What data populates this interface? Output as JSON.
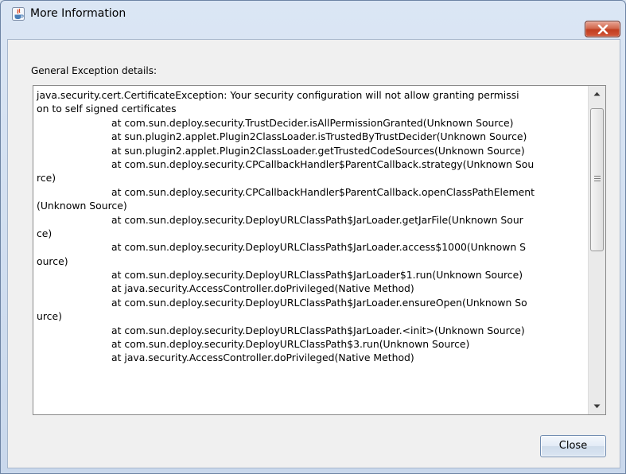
{
  "window": {
    "title": "More Information",
    "close_icon": "close-icon"
  },
  "section_label": "General Exception details:",
  "details_lines": [
    {
      "text": "java.security.cert.CertificateException: Your security configuration will not allow granting permissi",
      "indent": false
    },
    {
      "text": "on to self signed certificates",
      "indent": false
    },
    {
      "text": "at com.sun.deploy.security.TrustDecider.isAllPermissionGranted(Unknown Source)",
      "indent": true
    },
    {
      "text": "at sun.plugin2.applet.Plugin2ClassLoader.isTrustedByTrustDecider(Unknown Source)",
      "indent": true
    },
    {
      "text": "at sun.plugin2.applet.Plugin2ClassLoader.getTrustedCodeSources(Unknown Source)",
      "indent": true
    },
    {
      "text": "at com.sun.deploy.security.CPCallbackHandler$ParentCallback.strategy(Unknown Sou",
      "indent": true
    },
    {
      "text": "rce)",
      "indent": false
    },
    {
      "text": "at com.sun.deploy.security.CPCallbackHandler$ParentCallback.openClassPathElement",
      "indent": true
    },
    {
      "text": "(Unknown Source)",
      "indent": false
    },
    {
      "text": "at com.sun.deploy.security.DeployURLClassPath$JarLoader.getJarFile(Unknown Sour",
      "indent": true
    },
    {
      "text": "ce)",
      "indent": false
    },
    {
      "text": "at com.sun.deploy.security.DeployURLClassPath$JarLoader.access$1000(Unknown S",
      "indent": true
    },
    {
      "text": "ource)",
      "indent": false
    },
    {
      "text": "at com.sun.deploy.security.DeployURLClassPath$JarLoader$1.run(Unknown Source)",
      "indent": true
    },
    {
      "text": "at java.security.AccessController.doPrivileged(Native Method)",
      "indent": true
    },
    {
      "text": "at com.sun.deploy.security.DeployURLClassPath$JarLoader.ensureOpen(Unknown So",
      "indent": true
    },
    {
      "text": "urce)",
      "indent": false
    },
    {
      "text": "at com.sun.deploy.security.DeployURLClassPath$JarLoader.<init>(Unknown Source)",
      "indent": true
    },
    {
      "text": "at com.sun.deploy.security.DeployURLClassPath$3.run(Unknown Source)",
      "indent": true
    },
    {
      "text": "at java.security.AccessController.doPrivileged(Native Method)",
      "indent": true
    }
  ],
  "scrollbar": {
    "up_icon": "scroll-up-arrow-icon",
    "down_icon": "scroll-down-arrow-icon",
    "grip_icon": "scroll-grip-icon"
  },
  "close_button_label": "Close",
  "colors": {
    "titlebar": "#dbe6f4",
    "close_x": "#c13d1f",
    "client_bg": "#f0f0f0"
  }
}
